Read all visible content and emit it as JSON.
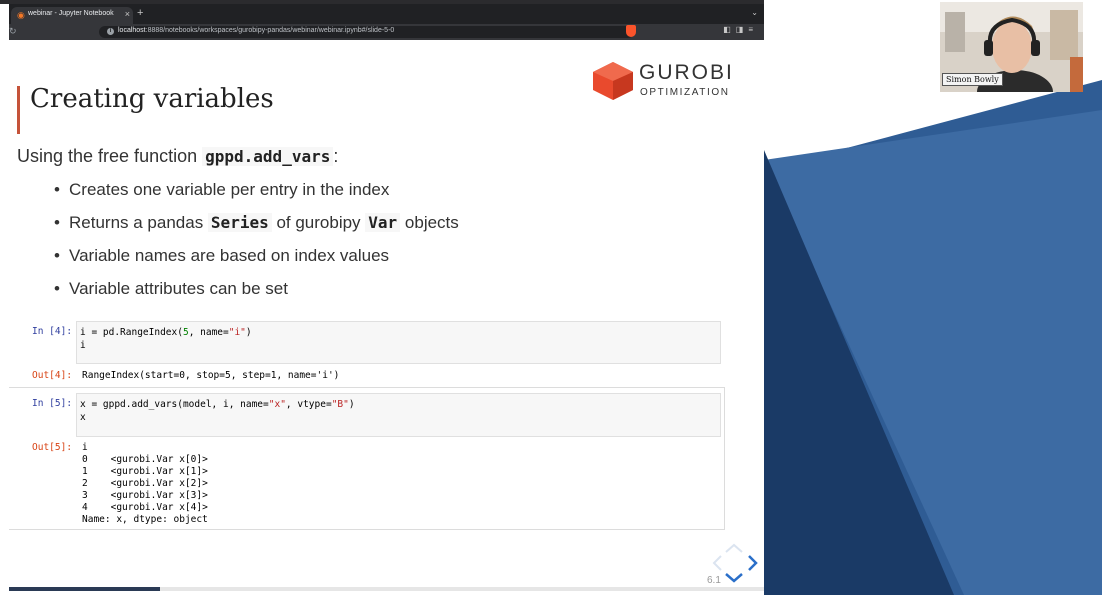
{
  "browser": {
    "tab_title": "webinar - Jupyter Notebook",
    "tab_close": "×",
    "new_tab": "+",
    "url_host": "localhost",
    "url_path": ":8888/notebooks/workspaces/gurobipy-pandas/webinar/webinar.ipynb#/slide-5-0"
  },
  "slide": {
    "title": "Creating variables",
    "logo": {
      "word": "GUROBI",
      "sub": "OPTIMIZATION",
      "accent": "#e94a2d"
    },
    "intro_text": "Using the free function",
    "intro_code": "gppd.add_vars",
    "intro_suffix": ":",
    "bullets": [
      {
        "pre": "Creates one variable per entry in the index",
        "code": "",
        "post": "",
        "code2": "",
        "post2": ""
      },
      {
        "pre": "Returns a pandas ",
        "code": "Series",
        "post": " of gurobipy ",
        "code2": "Var",
        "post2": " objects"
      },
      {
        "pre": "Variable names are based on index values",
        "code": "",
        "post": "",
        "code2": "",
        "post2": ""
      },
      {
        "pre": "Variable attributes can be set",
        "code": "",
        "post": "",
        "code2": "",
        "post2": ""
      }
    ],
    "cells": {
      "in4_prompt": "In [4]:",
      "in4_line1_a": "i = pd.RangeIndex(",
      "in4_line1_num": "5",
      "in4_line1_b": ", name=",
      "in4_line1_str": "\"i\"",
      "in4_line1_c": ")",
      "in4_line2": "i",
      "out4_prompt": "Out[4]:",
      "out4_text": "RangeIndex(start=0, stop=5, step=1, name='i')",
      "in5_prompt": "In [5]:",
      "in5_line1_a": "x = gppd.add_vars(model, i, name=",
      "in5_line1_str1": "\"x\"",
      "in5_line1_b": ", vtype=",
      "in5_line1_str2": "\"B\"",
      "in5_line1_c": ")",
      "in5_line2": "x",
      "out5_prompt": "Out[5]:",
      "out5_lines": [
        "i",
        "0    <gurobi.Var x[0]>",
        "1    <gurobi.Var x[1]>",
        "2    <gurobi.Var x[2]>",
        "3    <gurobi.Var x[3]>",
        "4    <gurobi.Var x[4]>",
        "Name: x, dtype: object"
      ]
    },
    "slide_number": "6.1",
    "progress": 0.2
  },
  "webcam": {
    "name": "Simon Bowly"
  }
}
